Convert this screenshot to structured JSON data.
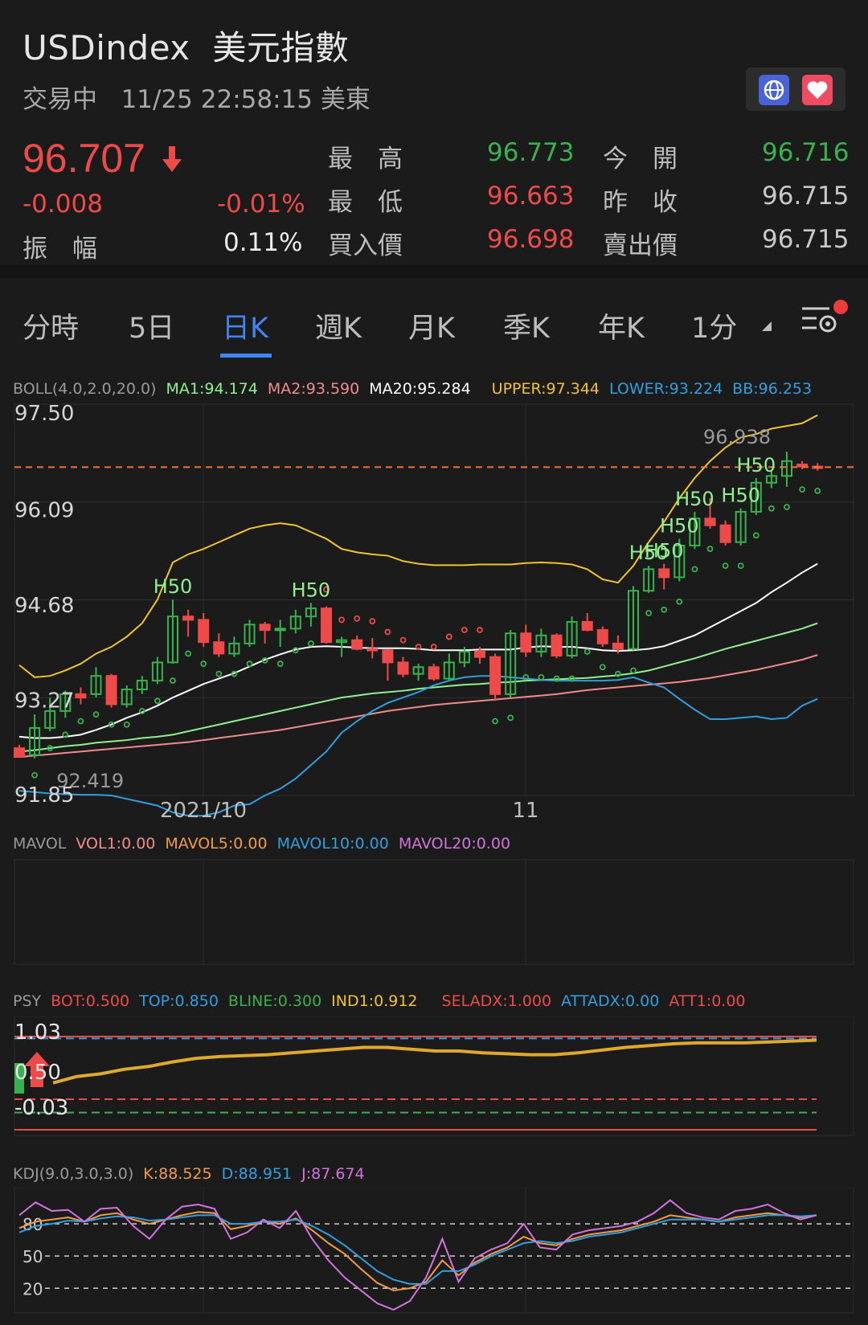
{
  "header": {
    "symbol": "USDindex",
    "name": "美元指數",
    "status": "交易中",
    "datetime": "11/25 22:58:15 美東"
  },
  "quote": {
    "price": "96.707",
    "change": "-0.008",
    "change_pct": "-0.01%",
    "amplitude_label": "振　幅",
    "amplitude": "0.11%",
    "high_label": "最　高",
    "high": "96.773",
    "low_label": "最　低",
    "low": "96.663",
    "bid_label": "買入價",
    "bid": "96.698",
    "open_label": "今　開",
    "open": "96.716",
    "prev_close_label": "昨　收",
    "prev_close": "96.715",
    "ask_label": "賣出價",
    "ask": "96.715"
  },
  "tabs": [
    {
      "label": "分時"
    },
    {
      "label": "5日"
    },
    {
      "label": "日K"
    },
    {
      "label": "週K"
    },
    {
      "label": "月K"
    },
    {
      "label": "季K"
    },
    {
      "label": "年K"
    },
    {
      "label": "1分"
    }
  ],
  "icons": {
    "globe": "globe-icon",
    "favorite": "heart-icon",
    "settings": "chart-settings-icon",
    "price_direction": "arrow-down-icon"
  },
  "colors": {
    "up": "#37b24d",
    "down": "#ef4a4a",
    "accent": "#3f86f3",
    "upper": "#f2c230",
    "lower": "#2f9fe0",
    "ma1": "#8ef28e",
    "ma2": "#f08b8b",
    "ma20": "#ffffff"
  },
  "boll_legend": {
    "name": "BOLL(4.0,2.0,20.0)",
    "ma1": "MA1:94.174",
    "ma2": "MA2:93.590",
    "ma20": "MA20:95.284",
    "upper": "UPPER:97.344",
    "lower": "LOWER:93.224",
    "bb": "BB:96.253"
  },
  "vol_legend": {
    "name": "MAVOL",
    "vol1": "VOL1:0.00",
    "mavol5": "MAVOL5:0.00",
    "mavol10": "MAVOL10:0.00",
    "mavol20": "MAVOL20:0.00"
  },
  "psy_legend": {
    "name": "PSY",
    "bot": "BOT:0.500",
    "top": "TOP:0.850",
    "bline": "BLINE:0.300",
    "ind1": "IND1:0.912",
    "seladx": "SELADX:1.000",
    "attadx": "ATTADX:0.00",
    "att1": "ATT1:0.00"
  },
  "kdj_legend": {
    "name": "KDJ(9.0,3.0,3.0)",
    "k": "K:88.525",
    "d": "D:88.951",
    "j": "J:87.674"
  },
  "chart_data": [
    {
      "type": "candlestick",
      "title": "",
      "ylim": [
        91.85,
        97.5
      ],
      "y_ticks": [
        "97.50",
        "96.09",
        "94.68",
        "93.27",
        "91.85"
      ],
      "x_ticks": [
        "2021/10",
        "11"
      ],
      "annotations": {
        "max": "96.938",
        "min": "92.419",
        "marker": "H50"
      },
      "h50_indices": [
        10,
        19,
        41,
        42,
        43,
        44,
        47,
        48
      ],
      "candles": [
        {
          "o": 92.55,
          "h": 92.6,
          "l": 92.45,
          "c": 92.42
        },
        {
          "o": 92.45,
          "h": 93.05,
          "l": 92.4,
          "c": 92.85
        },
        {
          "o": 92.85,
          "h": 93.3,
          "l": 92.8,
          "c": 93.1
        },
        {
          "o": 93.1,
          "h": 93.4,
          "l": 93.0,
          "c": 93.35
        },
        {
          "o": 93.35,
          "h": 93.45,
          "l": 93.2,
          "c": 93.3
        },
        {
          "o": 93.35,
          "h": 93.75,
          "l": 93.3,
          "c": 93.62
        },
        {
          "o": 93.62,
          "h": 93.65,
          "l": 93.15,
          "c": 93.2
        },
        {
          "o": 93.2,
          "h": 93.48,
          "l": 93.15,
          "c": 93.42
        },
        {
          "o": 93.42,
          "h": 93.62,
          "l": 93.35,
          "c": 93.55
        },
        {
          "o": 93.55,
          "h": 93.9,
          "l": 93.5,
          "c": 93.82
        },
        {
          "o": 93.82,
          "h": 94.75,
          "l": 93.8,
          "c": 94.5
        },
        {
          "o": 94.5,
          "h": 94.6,
          "l": 94.2,
          "c": 94.45
        },
        {
          "o": 94.45,
          "h": 94.55,
          "l": 94.05,
          "c": 94.12
        },
        {
          "o": 94.12,
          "h": 94.25,
          "l": 93.9,
          "c": 93.95
        },
        {
          "o": 93.95,
          "h": 94.2,
          "l": 93.9,
          "c": 94.1
        },
        {
          "o": 94.1,
          "h": 94.45,
          "l": 94.05,
          "c": 94.38
        },
        {
          "o": 94.38,
          "h": 94.42,
          "l": 94.1,
          "c": 94.3
        },
        {
          "o": 94.3,
          "h": 94.45,
          "l": 94.05,
          "c": 94.32
        },
        {
          "o": 94.32,
          "h": 94.6,
          "l": 94.25,
          "c": 94.5
        },
        {
          "o": 94.5,
          "h": 94.7,
          "l": 94.35,
          "c": 94.62
        },
        {
          "o": 94.62,
          "h": 94.65,
          "l": 94.1,
          "c": 94.12
        },
        {
          "o": 94.12,
          "h": 94.2,
          "l": 93.9,
          "c": 94.15
        },
        {
          "o": 94.15,
          "h": 94.22,
          "l": 94.0,
          "c": 94.02
        },
        {
          "o": 94.02,
          "h": 94.18,
          "l": 93.88,
          "c": 94.0
        },
        {
          "o": 94.0,
          "h": 94.02,
          "l": 93.55,
          "c": 93.82
        },
        {
          "o": 93.82,
          "h": 93.9,
          "l": 93.6,
          "c": 93.65
        },
        {
          "o": 93.65,
          "h": 93.8,
          "l": 93.55,
          "c": 93.75
        },
        {
          "o": 93.75,
          "h": 93.8,
          "l": 93.55,
          "c": 93.58
        },
        {
          "o": 93.58,
          "h": 93.95,
          "l": 93.55,
          "c": 93.82
        },
        {
          "o": 93.82,
          "h": 94.05,
          "l": 93.75,
          "c": 93.98
        },
        {
          "o": 93.98,
          "h": 94.05,
          "l": 93.8,
          "c": 93.9
        },
        {
          "o": 93.9,
          "h": 93.95,
          "l": 93.25,
          "c": 93.35
        },
        {
          "o": 93.35,
          "h": 94.3,
          "l": 93.3,
          "c": 94.25
        },
        {
          "o": 94.25,
          "h": 94.38,
          "l": 93.9,
          "c": 93.98
        },
        {
          "o": 93.98,
          "h": 94.32,
          "l": 93.9,
          "c": 94.22
        },
        {
          "o": 94.22,
          "h": 94.25,
          "l": 93.88,
          "c": 93.92
        },
        {
          "o": 93.92,
          "h": 94.5,
          "l": 93.88,
          "c": 94.42
        },
        {
          "o": 94.42,
          "h": 94.55,
          "l": 94.28,
          "c": 94.3
        },
        {
          "o": 94.3,
          "h": 94.35,
          "l": 94.05,
          "c": 94.1
        },
        {
          "o": 94.1,
          "h": 94.22,
          "l": 93.95,
          "c": 94.02
        },
        {
          "o": 94.02,
          "h": 94.95,
          "l": 94.0,
          "c": 94.88
        },
        {
          "o": 94.88,
          "h": 95.25,
          "l": 94.85,
          "c": 95.2
        },
        {
          "o": 95.2,
          "h": 95.28,
          "l": 94.9,
          "c": 95.08
        },
        {
          "o": 95.08,
          "h": 95.65,
          "l": 95.02,
          "c": 95.55
        },
        {
          "o": 95.55,
          "h": 96.05,
          "l": 95.5,
          "c": 95.95
        },
        {
          "o": 95.95,
          "h": 96.25,
          "l": 95.8,
          "c": 95.85
        },
        {
          "o": 95.85,
          "h": 95.92,
          "l": 95.55,
          "c": 95.6
        },
        {
          "o": 95.6,
          "h": 96.1,
          "l": 95.55,
          "c": 96.05
        },
        {
          "o": 96.05,
          "h": 96.55,
          "l": 96.0,
          "c": 96.48
        },
        {
          "o": 96.48,
          "h": 96.65,
          "l": 96.4,
          "c": 96.58
        },
        {
          "o": 96.58,
          "h": 96.94,
          "l": 96.42,
          "c": 96.8
        },
        {
          "o": 96.75,
          "h": 96.8,
          "l": 96.68,
          "c": 96.72
        },
        {
          "o": 96.72,
          "h": 96.77,
          "l": 96.66,
          "c": 96.71
        }
      ],
      "series": [
        {
          "name": "UPPER",
          "values": [
            93.78,
            93.6,
            93.62,
            93.7,
            93.8,
            93.95,
            94.05,
            94.2,
            94.4,
            94.75,
            95.3,
            95.42,
            95.5,
            95.6,
            95.7,
            95.8,
            95.85,
            95.88,
            95.85,
            95.75,
            95.65,
            95.5,
            95.45,
            95.42,
            95.4,
            95.32,
            95.28,
            95.26,
            95.26,
            95.26,
            95.27,
            95.27,
            95.27,
            95.29,
            95.3,
            95.29,
            95.27,
            95.2,
            95.05,
            95.0,
            95.25,
            95.6,
            95.9,
            96.25,
            96.55,
            96.8,
            97.0,
            97.15,
            97.2,
            97.28,
            97.32,
            97.36,
            97.48
          ]
        },
        {
          "name": "MA20",
          "values": [
            92.72,
            92.7,
            92.7,
            92.72,
            92.75,
            92.82,
            92.9,
            93.0,
            93.08,
            93.18,
            93.3,
            93.4,
            93.5,
            93.58,
            93.66,
            93.76,
            93.86,
            93.94,
            94.01,
            94.05,
            94.06,
            94.05,
            94.04,
            94.03,
            94.03,
            94.03,
            94.02,
            94.0,
            94.0,
            94.0,
            94.01,
            94.01,
            94.01,
            94.04,
            94.06,
            94.05,
            94.05,
            94.03,
            94.0,
            93.99,
            94.0,
            94.02,
            94.06,
            94.14,
            94.22,
            94.34,
            94.46,
            94.58,
            94.7,
            94.86,
            95.0,
            95.15,
            95.28
          ]
        },
        {
          "name": "MA1",
          "values": [
            92.5,
            92.52,
            92.55,
            92.58,
            92.6,
            92.63,
            92.65,
            92.67,
            92.7,
            92.72,
            92.75,
            92.8,
            92.85,
            92.9,
            92.95,
            93.0,
            93.05,
            93.1,
            93.15,
            93.2,
            93.25,
            93.3,
            93.33,
            93.36,
            93.38,
            93.4,
            93.43,
            93.45,
            93.47,
            93.49,
            93.5,
            93.52,
            93.53,
            93.55,
            93.56,
            93.57,
            93.58,
            93.59,
            93.61,
            93.63,
            93.66,
            93.7,
            93.76,
            93.82,
            93.88,
            93.95,
            94.02,
            94.08,
            94.14,
            94.2,
            94.26,
            94.32,
            94.4
          ]
        },
        {
          "name": "MA2",
          "values": [
            92.42,
            92.44,
            92.46,
            92.48,
            92.5,
            92.52,
            92.54,
            92.56,
            92.58,
            92.6,
            92.62,
            92.64,
            92.67,
            92.7,
            92.73,
            92.76,
            92.79,
            92.82,
            92.86,
            92.9,
            92.94,
            92.98,
            93.02,
            93.06,
            93.1,
            93.13,
            93.16,
            93.19,
            93.21,
            93.23,
            93.25,
            93.27,
            93.29,
            93.31,
            93.33,
            93.35,
            93.38,
            93.41,
            93.43,
            93.45,
            93.47,
            93.49,
            93.51,
            93.53,
            93.56,
            93.59,
            93.63,
            93.67,
            93.71,
            93.76,
            93.81,
            93.86,
            93.93
          ]
        },
        {
          "name": "LOWER",
          "values": [
            91.92,
            91.9,
            91.88,
            91.87,
            91.86,
            91.86,
            91.85,
            91.8,
            91.75,
            91.7,
            91.6,
            91.55,
            91.55,
            91.6,
            91.7,
            91.72,
            91.85,
            91.95,
            92.1,
            92.3,
            92.5,
            92.78,
            92.95,
            93.1,
            93.22,
            93.3,
            93.38,
            93.48,
            93.55,
            93.6,
            93.62,
            93.62,
            93.6,
            93.58,
            93.56,
            93.55,
            93.55,
            93.55,
            93.55,
            93.56,
            93.6,
            93.52,
            93.45,
            93.28,
            93.12,
            92.98,
            92.98,
            93.0,
            93.02,
            92.98,
            93.0,
            93.18,
            93.28
          ]
        }
      ]
    },
    {
      "type": "line",
      "title": "",
      "ylim": [
        -0.03,
        1.03
      ],
      "y_ticks": [
        "1.03",
        "0.50",
        "-0.03"
      ],
      "series": [
        {
          "name": "IND1",
          "values": [
            0.45,
            0.52,
            0.55,
            0.6,
            0.63,
            0.68,
            0.72,
            0.74,
            0.75,
            0.76,
            0.78,
            0.8,
            0.82,
            0.84,
            0.84,
            0.82,
            0.8,
            0.8,
            0.78,
            0.77,
            0.76,
            0.76,
            0.78,
            0.81,
            0.84,
            0.86,
            0.88,
            0.89,
            0.89,
            0.89,
            0.9,
            0.91,
            0.92
          ]
        }
      ]
    },
    {
      "type": "line",
      "title": "",
      "ylim": [
        0,
        110
      ],
      "y_ticks": [
        "80",
        "50",
        "20"
      ],
      "series": [
        {
          "name": "K",
          "values": [
            76,
            82,
            84,
            86,
            82,
            88,
            90,
            84,
            80,
            84,
            88,
            91,
            90,
            75,
            78,
            82,
            80,
            85,
            74,
            62,
            52,
            38,
            25,
            18,
            20,
            26,
            46,
            32,
            44,
            52,
            58,
            68,
            62,
            60,
            66,
            70,
            72,
            74,
            78,
            82,
            88,
            86,
            84,
            82,
            86,
            88,
            90,
            88,
            86,
            88
          ]
        },
        {
          "name": "D",
          "values": [
            72,
            78,
            80,
            83,
            82,
            85,
            87,
            86,
            83,
            84,
            86,
            88,
            88,
            80,
            80,
            82,
            82,
            84,
            78,
            70,
            60,
            48,
            36,
            28,
            24,
            24,
            36,
            36,
            42,
            50,
            56,
            62,
            64,
            62,
            64,
            68,
            70,
            72,
            76,
            80,
            84,
            84,
            84,
            82,
            84,
            86,
            88,
            88,
            87,
            88
          ]
        },
        {
          "name": "J",
          "values": [
            88,
            100,
            92,
            93,
            82,
            94,
            95,
            78,
            66,
            84,
            96,
            98,
            94,
            66,
            72,
            84,
            76,
            92,
            66,
            46,
            30,
            18,
            6,
            0,
            8,
            30,
            66,
            26,
            48,
            56,
            62,
            80,
            58,
            56,
            70,
            74,
            76,
            78,
            82,
            90,
            102,
            90,
            86,
            84,
            92,
            94,
            98,
            90,
            84,
            88
          ]
        }
      ]
    }
  ]
}
